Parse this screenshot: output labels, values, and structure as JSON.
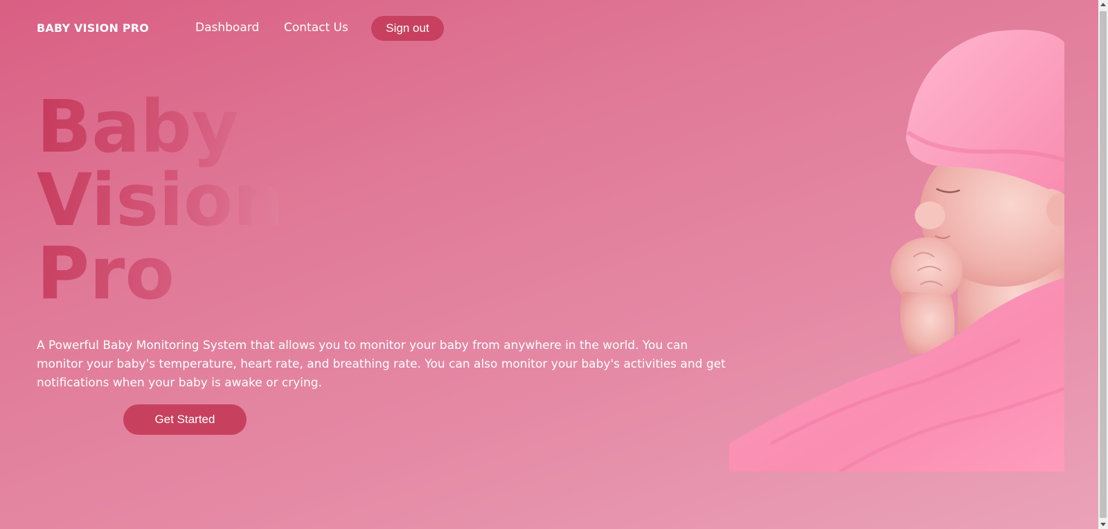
{
  "nav": {
    "brand": "BABY VISION PRO",
    "links": [
      "Dashboard",
      "Contact Us"
    ],
    "signout_label": "Sign out"
  },
  "hero": {
    "title_lines": [
      "Baby",
      "Vision",
      "Pro"
    ],
    "description": "A Powerful Baby Monitoring System that allows you to monitor your baby from anywhere in the world. You can monitor your baby's temperature, heart rate, and breathing rate. You can also monitor your baby's activities and get notifications when your baby is awake or crying.",
    "cta_label": "Get Started"
  },
  "colors": {
    "background_start": "#d95f83",
    "background_end": "#eaa3b9",
    "button": "#c8405f",
    "title_gradient_start": "#c63a5c",
    "title_gradient_end": "#e386a3"
  }
}
